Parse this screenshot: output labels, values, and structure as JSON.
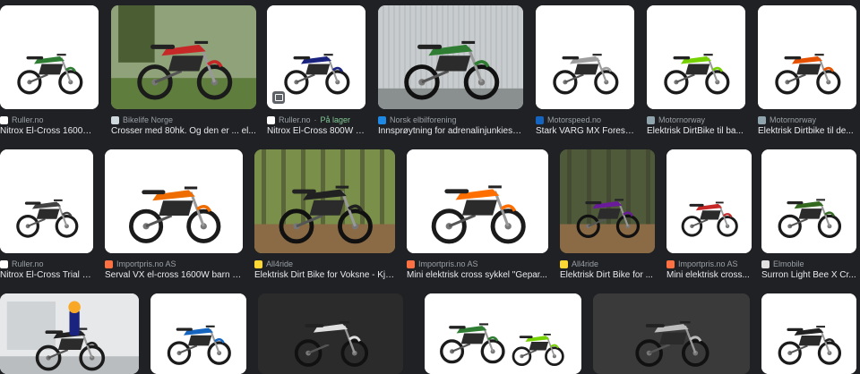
{
  "results": [
    {
      "source": "Ruller.no",
      "title": "Nitrox El-Cross 1600W ...",
      "fav": "#ffffff",
      "bg": "#ffffff",
      "bike": "#2e7d32",
      "scene": "studio"
    },
    {
      "source": "Bikelife Norge",
      "title": "Crosser med 80hk. Og den er ... el...",
      "fav": "#cfd8dc",
      "bg": "#6d8a55",
      "bike": "#c62828",
      "scene": "outdoor"
    },
    {
      "source": "Ruller.no",
      "stock": "På lager",
      "title": "Nitrox El-Cross 800W -...",
      "fav": "#ffffff",
      "bg": "#ffffff",
      "bike": "#1a237e",
      "scene": "studio",
      "badge": true
    },
    {
      "source": "Norsk elbilforening",
      "title": "Innsprøytning for adrenalinjunkies -...",
      "fav": "#1e88e5",
      "bg": "#b0b5b8",
      "bike": "#2e7d32",
      "scene": "wall"
    },
    {
      "source": "Motorspeed.no",
      "title": "Stark VARG MX Forest...",
      "fav": "#1565c0",
      "bg": "#ffffff",
      "bike": "#9e9e9e",
      "scene": "studio"
    },
    {
      "source": "Motornorway",
      "title": "Elektrisk DirtBike til ba...",
      "fav": "#90a4ae",
      "bg": "#ffffff",
      "bike": "#76d100",
      "scene": "studio"
    },
    {
      "source": "Motornorway",
      "title": "Elektrisk Dirtbike til de...",
      "fav": "#90a4ae",
      "bg": "#ffffff",
      "bike": "#e65100",
      "scene": "studio"
    },
    {
      "source": "Ruller.no",
      "title": "Nitrox El-Cross Trial 1...",
      "fav": "#ffffff",
      "bg": "#ffffff",
      "bike": "#424242",
      "scene": "studio"
    },
    {
      "source": "Importpris.no AS",
      "title": "Serval VX el-cross 1600W barn 1...",
      "fav": "#ff7043",
      "bg": "#ffffff",
      "bike": "#ef6c00",
      "scene": "studio"
    },
    {
      "source": "All4ride",
      "title": "Elektrisk Dirt Bike for Voksne - Kjø...",
      "fav": "#fdd835",
      "bg": "#7a8f4a",
      "bike": "#212121",
      "scene": "forest"
    },
    {
      "source": "Importpris.no AS",
      "title": "Mini elektrisk cross sykkel \"Gepar...",
      "fav": "#ff7043",
      "bg": "#ffffff",
      "bike": "#ff6f00",
      "scene": "studio"
    },
    {
      "source": "All4ride",
      "title": "Elektrisk Dirt Bike for ...",
      "fav": "#fdd835",
      "bg": "#4e5a3a",
      "bike": "#6a1b9a",
      "scene": "forest"
    },
    {
      "source": "Importpris.no AS",
      "title": "Mini elektrisk cross...",
      "fav": "#ff7043",
      "bg": "#ffffff",
      "bike": "#c62828",
      "scene": "studio"
    },
    {
      "source": "Elmobile",
      "title": "Surron Light Bee X Cr...",
      "fav": "#e0e0e0",
      "bg": "#ffffff",
      "bike": "#33691e",
      "scene": "studio"
    },
    {
      "bg": "#dfe3e6",
      "bike": "#212121",
      "scene": "rider"
    },
    {
      "bg": "#ffffff",
      "bike": "#1565c0",
      "scene": "studio"
    },
    {
      "bg": "#2b2b2b",
      "bike": "#e0e0e0",
      "scene": "dark"
    },
    {
      "bg": "#ffffff",
      "bike": "#2e7d32",
      "scene": "pair"
    },
    {
      "bg": "#3a3a3a",
      "bike": "#bdbdbd",
      "scene": "dark"
    },
    {
      "bg": "#ffffff",
      "bike": "#212121",
      "scene": "studio"
    }
  ]
}
